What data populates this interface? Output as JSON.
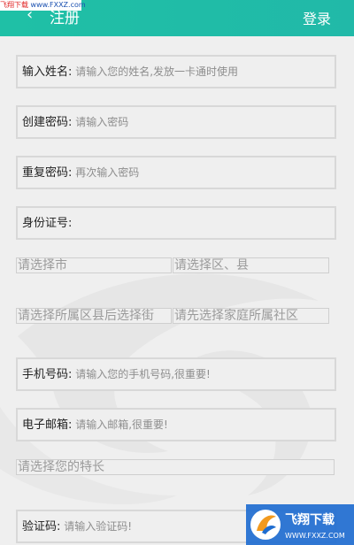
{
  "watermark": {
    "part1": "飞翔下载",
    "part2": "www.FXXZ.com"
  },
  "header": {
    "back_icon": "‹",
    "title": "注册",
    "login_label": "登录"
  },
  "form": {
    "name": {
      "label": "输入姓名:",
      "placeholder": "请输入您的姓名,发放一卡通时使用"
    },
    "password": {
      "label": "创建密码:",
      "placeholder": "请输入密码"
    },
    "password_repeat": {
      "label": "重复密码:",
      "placeholder": "再次输入密码"
    },
    "id_card": {
      "label": "身份证号:",
      "placeholder": ""
    },
    "city_select": "请选择市",
    "district_select": "请选择区、县",
    "street_select": "请选择所属区县后选择街",
    "community_select": "请先选择家庭所属社区",
    "phone": {
      "label": "手机号码:",
      "placeholder": "请输入您的手机号码,很重要!"
    },
    "email": {
      "label": "电子邮箱:",
      "placeholder": "请输入邮箱,很重要!"
    },
    "specialty_select": "请选择您的特长",
    "code": {
      "label": "验证码:",
      "placeholder": "请输入验证码!"
    }
  },
  "brand_watermark": {
    "name": "飞翔下载",
    "url": "WWW.FXXZ.COM"
  },
  "colors": {
    "header": "#1fc0a6",
    "field_border": "#d8d8d8",
    "background": "#efefef"
  }
}
